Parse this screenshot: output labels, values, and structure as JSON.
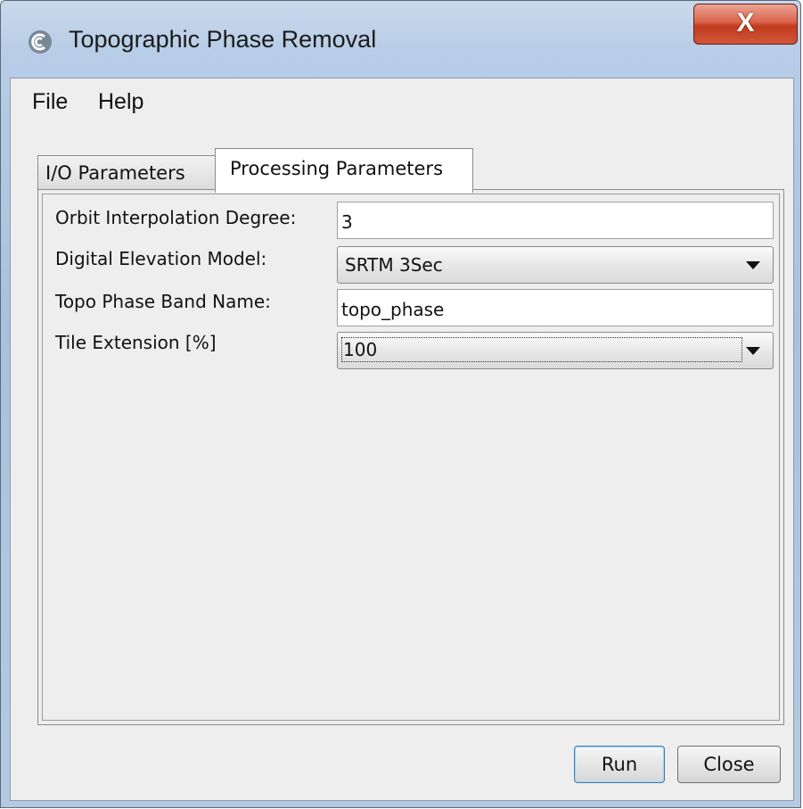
{
  "window": {
    "title": "Topographic Phase Removal",
    "close_glyph": "X",
    "app_icon": "esa-app-icon"
  },
  "menu": {
    "file": "File",
    "help": "Help"
  },
  "tabs": [
    {
      "label": "I/O Parameters",
      "active": false
    },
    {
      "label": "Processing Parameters",
      "active": true
    }
  ],
  "form": {
    "orbit_degree": {
      "label": "Orbit Interpolation Degree:",
      "value": "3"
    },
    "dem": {
      "label": "Digital Elevation Model:",
      "selected": "SRTM 3Sec"
    },
    "topo_band": {
      "label": "Topo Phase Band Name:",
      "value": "topo_phase"
    },
    "tile_ext": {
      "label": "Tile Extension [%]",
      "selected": "100"
    }
  },
  "buttons": {
    "run": "Run",
    "close": "Close"
  },
  "colors": {
    "title_bar": "#b8cde6",
    "close_button": "#c94a2c",
    "panel": "#eeeeee"
  }
}
